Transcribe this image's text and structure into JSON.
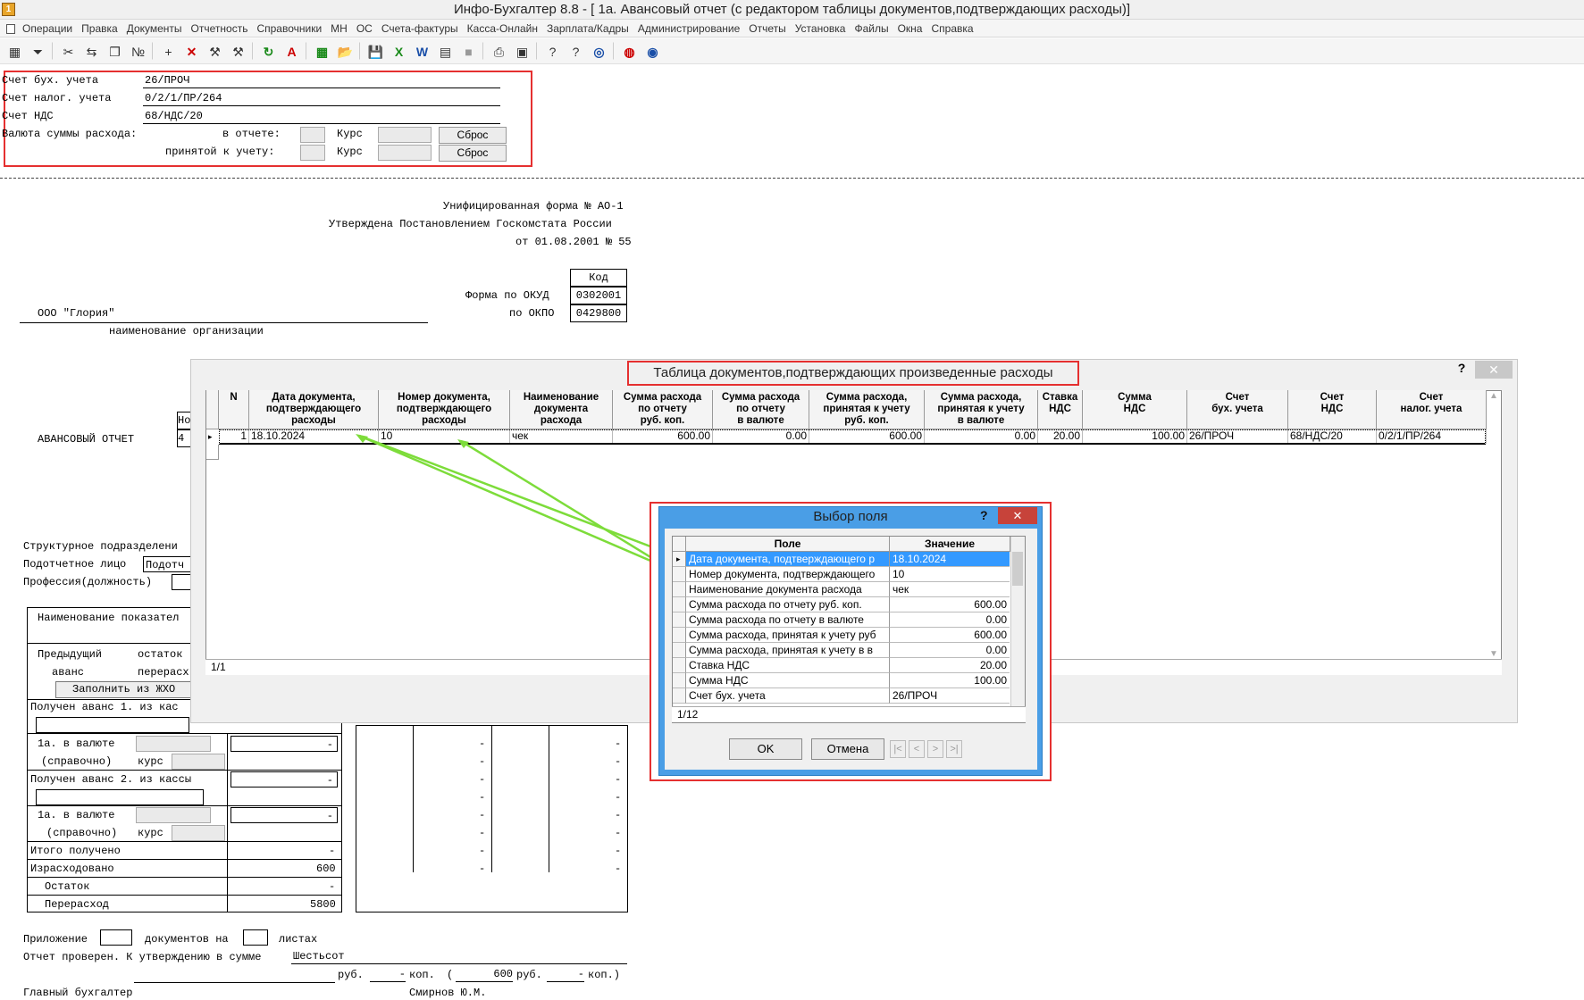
{
  "window": {
    "icon_label": "1",
    "title": "Инфо-Бухгалтер 8.8 - [  1а. Авансовый отчет (с редактором таблицы документов,подтверждающих расходы)]"
  },
  "menu": [
    "Операции",
    "Правка",
    "Документы",
    "Отчетность",
    "Справочники",
    "МН",
    "ОС",
    "Счета-фактуры",
    "Касса-Онлайн",
    "Зарплата/Кадры",
    "Администрирование",
    "Отчеты",
    "Установка",
    "Файлы",
    "Окна",
    "Справка"
  ],
  "toolbar": {
    "icons": [
      "table-icon",
      "filter-icon",
      "cut-icon",
      "paste-icon",
      "copy-icon",
      "numbering-icon",
      "add-icon",
      "delete-icon",
      "tool-icon",
      "tool2-icon",
      "refresh-icon",
      "pdf-icon",
      "calc-icon",
      "open-icon",
      "save-icon",
      "excel-icon",
      "word-icon",
      "sheet-icon",
      "gray-icon",
      "print-icon",
      "preview-icon",
      "help-icon",
      "context-help-icon",
      "compass-icon",
      "lifebuoy-icon",
      "globe-icon"
    ],
    "glyphs": [
      "▦",
      "⏷",
      "✂",
      "⇆",
      "❐",
      "№",
      "+",
      "✕",
      "⚒",
      "⚒",
      "↻",
      "A",
      "▦",
      "📂",
      "💾",
      "X",
      "W",
      "▤",
      "■",
      "⎙",
      "▣",
      "?",
      "?",
      "◎",
      "◍",
      "◉"
    ]
  },
  "accounts": {
    "bu_label": "Счет бух. учета",
    "bu_value": "26/ПРОЧ",
    "nu_label": "Счет налог. учета",
    "nu_value": "0/2/1/ПР/264",
    "nds_label": "Счет НДС",
    "nds_value": "68/НДС/20",
    "currency_label": "Валюта суммы расхода:",
    "in_report_label": "в отчете:",
    "accepted_label": "принятой к учету:",
    "rate_label": "Курс",
    "reset_label": "Сброс"
  },
  "form_header": {
    "line1": "Унифицированная форма № АО-1",
    "line2": "Утверждена Постановлением Госкомстата России",
    "line3": "от 01.08.2001 № 55",
    "code_header": "Код",
    "okud_label": "Форма по ОКУД",
    "okud_value": "0302001",
    "okpo_label": "по ОКПО",
    "okpo_value": "0429800",
    "org_name": "ООО \"Глория\"",
    "org_caption": "наименование организации",
    "report_title": "АВАНСОВЫЙ ОТЧЕТ",
    "no_label": "Но",
    "no_value": "4"
  },
  "form_body": {
    "struct_label": "Структурное подразделени",
    "person_label": "Подотчетное лицо",
    "person_value": "Подотч",
    "profession_label": "Профессия(должность)",
    "indicator_header": "Наименование показател",
    "prev_label": "Предыдущий",
    "prev_remain": "остаток",
    "advance_label": "аванс",
    "overspend_short": "перерасх",
    "fill_button": "Заполнить из ЖХО",
    "received1": "Получен аванс 1. из кас",
    "in_currency1": "1а. в валюте",
    "reference1": "(справочно)",
    "rate_label": "курс",
    "received2": "Получен аванс 2. из кассы",
    "in_currency2": "1а. в валюте",
    "reference2": "(справочно)",
    "total_received": "Итого получено",
    "spent": "Израсходовано",
    "spent_value": "600",
    "remain": "Остаток",
    "overspend": "Перерасход",
    "overspend_value": "5800",
    "dash": "-"
  },
  "form_footer": {
    "attachment": "Приложение",
    "docs_on": "документов на",
    "sheets": "листах",
    "checked": "Отчет проверен. К утверждению в сумме",
    "amount_words": "Шестьсот",
    "rub": "руб.",
    "kop": "коп.",
    "open_paren": "(",
    "amount_num": "600",
    "kop_close": "коп.)",
    "dash": "-",
    "chief_accountant": "Главный бухгалтер",
    "chief_name": "Смирнов Ю.М."
  },
  "docs_dialog": {
    "title": "Таблица документов,подтверждающих произведенные расходы",
    "help": "?",
    "close": "✕",
    "columns": [
      "N",
      "Дата документа,\nподтверждающего\nрасходы",
      "Номер документа,\nподтверждающего\nрасходы",
      "Наименование\nдокумента\nрасхода",
      "Сумма расхода\nпо отчету\nруб. коп.",
      "Сумма расхода\nпо отчету\nв валюте",
      "Сумма расхода,\nпринятая к учету\nруб. коп.",
      "Сумма расхода,\nпринятая к учету\nв валюте",
      "Ставка\nНДС",
      "Сумма\nНДС",
      "Счет\nбух. учета",
      "Счет\nНДС",
      "Счет\nналог. учета"
    ],
    "row": [
      "1",
      "18.10.2024",
      "10",
      "чек",
      "600.00",
      "0.00",
      "600.00",
      "0.00",
      "20.00",
      "100.00",
      "26/ПРОЧ",
      "68/НДС/20",
      "0/2/1/ПР/264"
    ],
    "status": "1/1"
  },
  "picker": {
    "title": "Выбор поля",
    "help": "?",
    "close": "✕",
    "col_field": "Поле",
    "col_value": "Значение",
    "rows": [
      {
        "field": "Дата документа, подтверждающего р",
        "value": "18.10.2024",
        "num": false
      },
      {
        "field": "Номер документа, подтверждающего",
        "value": "10",
        "num": false
      },
      {
        "field": "Наименование документа расхода",
        "value": "чек",
        "num": false
      },
      {
        "field": "Сумма расхода по отчету руб. коп.",
        "value": "600.00",
        "num": true
      },
      {
        "field": "Сумма расхода по отчету в валюте",
        "value": "0.00",
        "num": true
      },
      {
        "field": "Сумма расхода, принятая к учету руб",
        "value": "600.00",
        "num": true
      },
      {
        "field": "Сумма расхода, принятая к учету в в",
        "value": "0.00",
        "num": true
      },
      {
        "field": "Ставка НДС",
        "value": "20.00",
        "num": true
      },
      {
        "field": "Сумма НДС",
        "value": "100.00",
        "num": true
      },
      {
        "field": "Счет бух. учета",
        "value": "26/ПРОЧ",
        "num": false
      }
    ],
    "status": "1/12",
    "ok": "OK",
    "cancel": "Отмена",
    "nav": [
      "|<",
      "<",
      ">",
      ">|"
    ]
  },
  "colors": {
    "highlight_red": "#e53030",
    "arrow_green": "#7ddc3a",
    "picker_blue": "#4a9ee6",
    "selection_blue": "#3399ff"
  }
}
